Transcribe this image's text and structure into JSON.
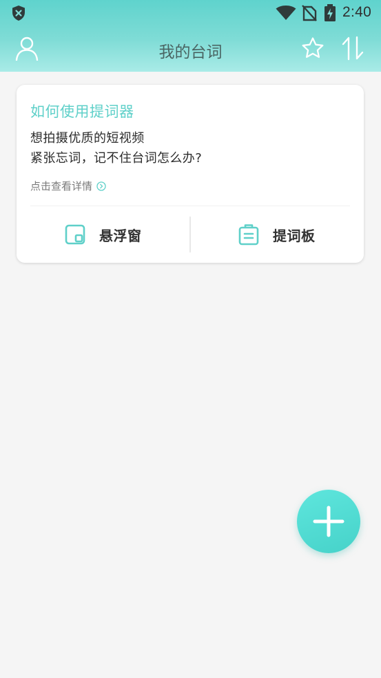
{
  "status_bar": {
    "time": "2:40",
    "icons": [
      "shield-icon",
      "wifi-icon",
      "no-sim-icon",
      "battery-charging-icon"
    ]
  },
  "app_bar": {
    "title": "我的台词",
    "left_icon": "person-icon",
    "right_icons": [
      "star-icon",
      "sort-icon"
    ]
  },
  "guide_card": {
    "title": "如何使用提词器",
    "lines": [
      "想拍摄优质的短视频",
      "紧张忘词，记不住台词怎么办?"
    ],
    "details_link": "点击查看详情",
    "actions": [
      {
        "label": "悬浮窗",
        "icon": "floating-window-icon"
      },
      {
        "label": "提词板",
        "icon": "clipboard-icon"
      }
    ]
  },
  "fab": {
    "icon": "plus-icon"
  },
  "colors": {
    "accent": "#5fd0c9",
    "header_top": "#5fd3cd",
    "header_bottom": "#a9ebe7",
    "background": "#f5f5f5"
  }
}
